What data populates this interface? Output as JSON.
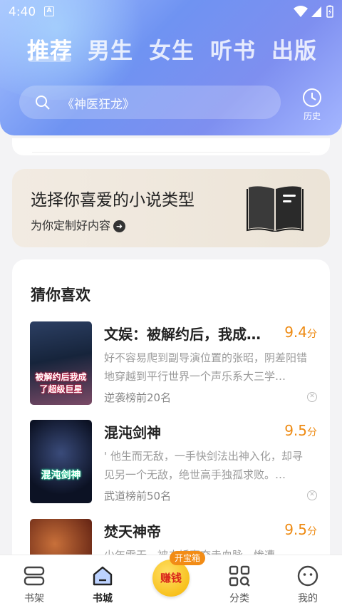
{
  "status": {
    "time": "4:40",
    "app_badge": "A"
  },
  "tabs": [
    {
      "label": "推荐",
      "active": true
    },
    {
      "label": "男生",
      "active": false
    },
    {
      "label": "女生",
      "active": false
    },
    {
      "label": "听书",
      "active": false
    },
    {
      "label": "出版",
      "active": false
    }
  ],
  "search": {
    "placeholder": "《神医狂龙》",
    "history_label": "历史"
  },
  "banner": {
    "title": "选择你喜爱的小说类型",
    "subtitle": "为你定制好内容"
  },
  "section": {
    "title": "猜你喜欢"
  },
  "books": [
    {
      "title": "文娱：被解约后，我成…",
      "score": "9.4",
      "unit": "分",
      "desc": "好不容易爬到副导演位置的张昭，阴差阳错地穿越到平行世界一个声乐系大三学…",
      "rank": "逆袭榜前20名",
      "cover_text": "被解约后我成了超级巨星"
    },
    {
      "title": "混沌剑神",
      "score": "9.5",
      "unit": "分",
      "desc": "' 他生而无敌，一手快剑法出神入化，却寻见另一个无敌，绝世高手独孤求败。…",
      "rank": "武道榜前50名",
      "cover_text": "混沌剑神"
    },
    {
      "title": "焚天神帝",
      "score": "9.5",
      "unit": "分",
      "desc": "少年雷无，被未婚妻夺走血脉，惨遭…",
      "rank": "",
      "cover_text": ""
    }
  ],
  "bottom_nav": [
    {
      "label": "书架",
      "icon": "bookshelf-icon"
    },
    {
      "label": "书城",
      "icon": "bookstore-icon",
      "active": true
    },
    {
      "label": "赚钱",
      "badge": "开宝箱",
      "icon": "coin-icon"
    },
    {
      "label": "分类",
      "icon": "category-icon"
    },
    {
      "label": "我的",
      "icon": "profile-icon"
    }
  ]
}
